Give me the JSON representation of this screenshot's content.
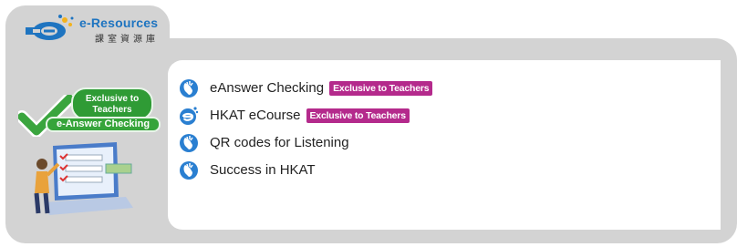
{
  "logo": {
    "title": "e-Resources",
    "subtitle": "課室資源庫",
    "icon": "eresources-logo-icon",
    "colors": {
      "primary": "#1e74c0",
      "accent": "#f3b21c"
    }
  },
  "left_panel": {
    "badge_top_line1": "Exclusive to",
    "badge_top_line2": "Teachers",
    "badge_bottom": "e-Answer Checking",
    "illustration": "laptop-checklist-illustration",
    "badge_color": "#2f9b35"
  },
  "resources": [
    {
      "label": "eAnswer Checking",
      "icon": "mouse-click-icon",
      "tag": "Exclusive to Teachers"
    },
    {
      "label": "HKAT eCourse",
      "icon": "ecourse-icon",
      "tag": "Exclusive to Teachers"
    },
    {
      "label": "QR codes for Listening",
      "icon": "mouse-click-icon",
      "tag": ""
    },
    {
      "label": "Success in HKAT",
      "icon": "mouse-click-icon",
      "tag": ""
    }
  ],
  "tag_color": "#b42a8c",
  "panel_color": "#d3d3d3"
}
